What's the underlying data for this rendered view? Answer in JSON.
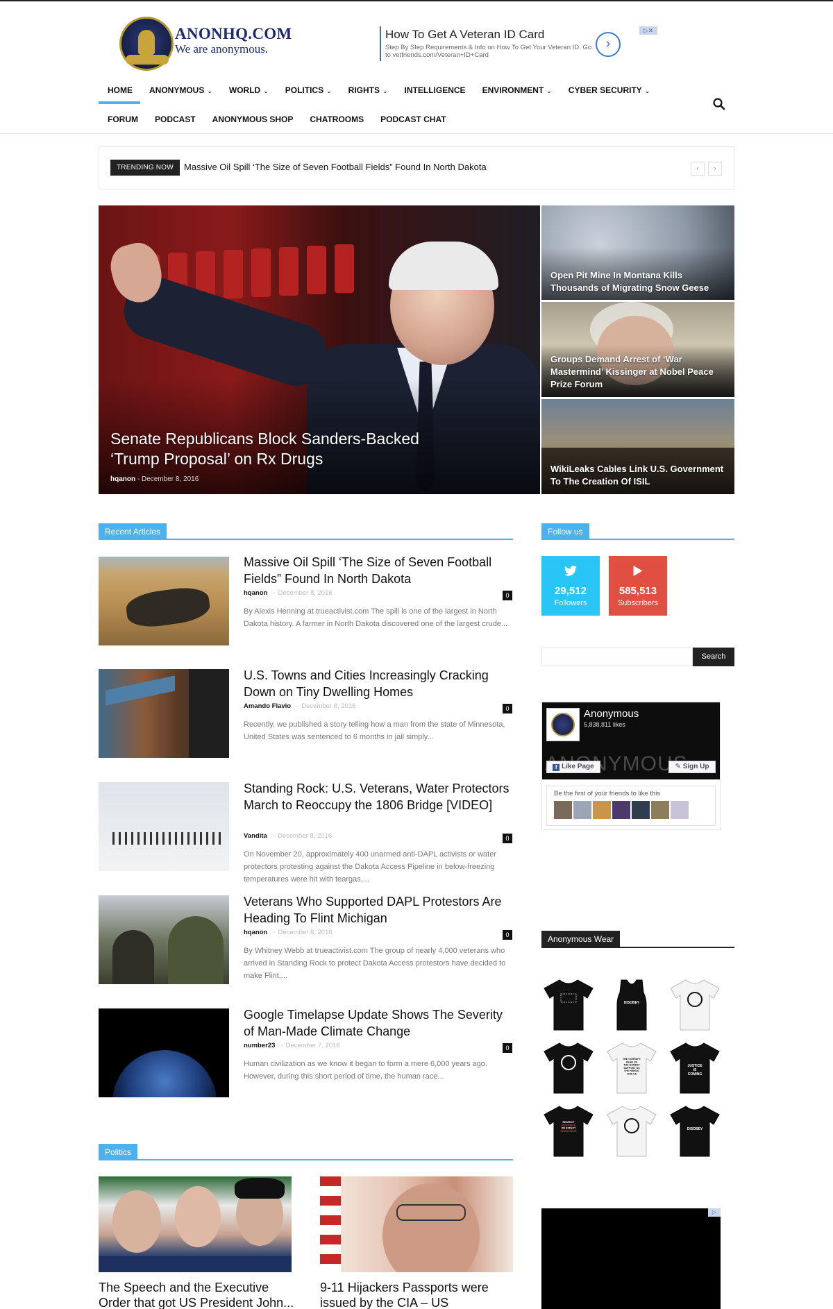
{
  "site": {
    "name": "ANONHQ.COM",
    "tagline": "We are anonymous."
  },
  "ad": {
    "headline": "How To Get A Veteran ID Card",
    "text": "Step By Step Requirements & Info on How To Get Your Veteran ID. Go to vetfriends.com/Veteran+ID+Card",
    "arrow": "›",
    "badge": "▷✕"
  },
  "nav": {
    "primary": [
      {
        "label": "HOME",
        "dropdown": false
      },
      {
        "label": "ANONYMOUS",
        "dropdown": true
      },
      {
        "label": "WORLD",
        "dropdown": true
      },
      {
        "label": "POLITICS",
        "dropdown": true
      },
      {
        "label": "RIGHTS",
        "dropdown": true
      },
      {
        "label": "INTELLIGENCE",
        "dropdown": false
      },
      {
        "label": "ENVIRONMENT",
        "dropdown": true
      },
      {
        "label": "CYBER SECURITY",
        "dropdown": true
      }
    ],
    "secondary": [
      "FORUM",
      "PODCAST",
      "ANONYMOUS SHOP",
      "CHATROOMS",
      "PODCAST CHAT"
    ],
    "dropdown_icon": "chevron-down-icon",
    "search_icon": "search-icon"
  },
  "trending": {
    "tag": "TRENDING NOW",
    "text": "Massive Oil Spill ‘The Size of Seven Football Fields” Found In North Dakota",
    "prev": "‹",
    "next": "›"
  },
  "featured": {
    "main": {
      "title": "Senate Republicans Block Sanders-Backed ‘Trump Proposal’ on Rx Drugs",
      "author": "hqanon",
      "date": "December 8, 2016"
    },
    "side": [
      {
        "title": "Open Pit Mine In Montana Kills Thousands of Migrating Snow Geese"
      },
      {
        "title": "Groups Demand Arrest of ‘War Mastermind’ Kissinger at Nobel Peace Prize Forum"
      },
      {
        "title": "WikiLeaks Cables Link U.S. Government To The Creation Of ISIL"
      }
    ]
  },
  "recent": {
    "heading": "Recent Articles",
    "articles": [
      {
        "title": "Massive Oil Spill ‘The Size of Seven Football Fields” Found In North Dakota",
        "author": "hqanon",
        "date": "December 8, 2016",
        "comments": "0",
        "excerpt": "By Alexis Henning at trueactivist.com The spill is one of the largest in North Dakota history. A farmer in North Dakota discovered one of the largest crude..."
      },
      {
        "title": "U.S. Towns and Cities Increasingly Cracking Down on Tiny Dwelling Homes",
        "author": "Amando Flavio",
        "date": "December 8, 2016",
        "comments": "0",
        "excerpt": "Recently, we published a story telling how a man from the state of Minnesota, United States was sentenced to 6 months in jail simply..."
      },
      {
        "title": "Standing Rock: U.S. Veterans, Water Protectors March to Reoccupy the 1806 Bridge [VIDEO]",
        "author": "Vandita",
        "date": "December 8, 2016",
        "comments": "0",
        "excerpt": "On November 20, approximately 400 unarmed anti-DAPL activists or water protectors protesting against the Dakota Access Pipeline in below-freezing temperatures were hit with teargas,..."
      },
      {
        "title": "Veterans Who Supported DAPL Protestors Are Heading To Flint Michigan",
        "author": "hqanon",
        "date": "December 8, 2016",
        "comments": "0",
        "excerpt": "By Whitney Webb at trueactivist.com The group of nearly 4,000 veterans who arrived in Standing Rock to protect Dakota Access protestors have decided to make Flint,..."
      },
      {
        "title": "Google Timelapse Update Shows The Severity of Man-Made Climate Change",
        "author": "number23",
        "date": "December 7, 2016",
        "comments": "0",
        "excerpt": "Human civilization as we know it began to form a mere 6,000 years ago. However, during this short period of time, the human race..."
      }
    ]
  },
  "sidebar": {
    "follow_heading": "Follow us",
    "twitter": {
      "count": "29,512",
      "label": "Followers",
      "color": "#29c5f6",
      "icon": "twitter-icon"
    },
    "youtube": {
      "count": "585,513",
      "label": "Subscribers",
      "color": "#e14e42",
      "icon": "youtube-play-icon"
    },
    "search_button": "Search",
    "facebook": {
      "name": "Anonymous",
      "likes": "5,838,811 likes",
      "cover_text": "ANONYMOUS",
      "like_button": "Like Page",
      "signup_button": "Sign Up",
      "friends_text": "Be the first of your friends to like this"
    },
    "wear_heading": "Anonymous Wear",
    "tee_prints": [
      {
        "lines": []
      },
      {
        "lines": [
          "DISOBEY"
        ]
      },
      {
        "lines": []
      },
      {
        "lines": []
      },
      {
        "lines": [
          "THE CORRUPT",
          "FEAR US",
          "THE HONEST",
          "SUPPORT US",
          "THE HEROIC",
          "JOIN US"
        ]
      },
      {
        "lines": [
          "JUSTICE",
          "IS",
          "COMING"
        ]
      },
      {
        "lines": [
          "RESPECT",
          "EXISTENCE",
          "OR EXPECT",
          "RESISTANCE"
        ]
      },
      {
        "lines": []
      },
      {
        "lines": [
          "DISOBEY"
        ]
      }
    ],
    "ad_badge": "▷"
  },
  "politics": {
    "heading": "Politics",
    "articles": [
      {
        "title": "The Speech and the Executive Order that got US President John..."
      },
      {
        "title": "9-11 Hijackers Passports were issued by the CIA – US"
      }
    ]
  },
  "colors": {
    "accent": "#4db2ec",
    "dark": "#222222",
    "logo_blue": "#1d2a6e"
  }
}
